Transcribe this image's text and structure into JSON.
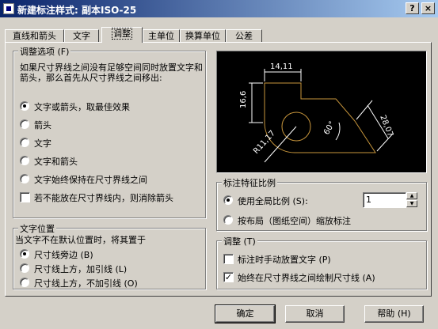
{
  "window": {
    "title": "新建标注样式: 副本ISO-25",
    "help_glyph": "?",
    "close_glyph": "×"
  },
  "tabs": [
    {
      "label": "直线和箭头"
    },
    {
      "label": "文字"
    },
    {
      "label": "调整"
    },
    {
      "label": "主单位"
    },
    {
      "label": "换算单位"
    },
    {
      "label": "公差"
    }
  ],
  "fit_options": {
    "title": "调整选项",
    "hotkey": "(F)",
    "description": "如果尺寸界线之间没有足够空间同时放置文字和箭头，那么首先从尺寸界线之间移出:",
    "options": [
      {
        "label": "文字或箭头，取最佳效果",
        "selected": true
      },
      {
        "label": "箭头",
        "selected": false
      },
      {
        "label": "文字",
        "selected": false
      },
      {
        "label": "文字和箭头",
        "selected": false
      },
      {
        "label": "文字始终保持在尺寸界线之间",
        "selected": false
      }
    ],
    "suppress_arrows": {
      "label": "若不能放在尺寸界线内，则消除箭头",
      "checked": false
    }
  },
  "text_placement": {
    "title": "文字位置",
    "description": "当文字不在默认位置时，将其置于",
    "options": [
      {
        "label": "尺寸线旁边",
        "hotkey": "(B)",
        "selected": true
      },
      {
        "label": "尺寸线上方，加引线",
        "hotkey": "(L)",
        "selected": false
      },
      {
        "label": "尺寸线上方，不加引线",
        "hotkey": "(O)",
        "selected": false
      }
    ]
  },
  "preview": {
    "dims": {
      "top": "14,11",
      "left": "16,6",
      "right": "28,07",
      "angle": "60°",
      "radius": "R11,17"
    },
    "colors": {
      "geometry": "#c8963c",
      "dimension": "#ffffff",
      "background": "#000000"
    }
  },
  "scale": {
    "title": "标注特征比例",
    "use_global": {
      "label": "使用全局比例",
      "hotkey": "(S):",
      "selected": true
    },
    "global_value": "1",
    "layout": {
      "label": "按布局（图纸空间）缩放标注",
      "selected": false
    }
  },
  "fine_tuning": {
    "title": "调整",
    "hotkey": "(T)",
    "manual": {
      "label": "标注时手动放置文字",
      "hotkey": "(P)",
      "checked": false
    },
    "always_draw": {
      "label": "始终在尺寸界线之间绘制尺寸线",
      "hotkey": "(A)",
      "checked": true
    }
  },
  "buttons": {
    "ok": "确定",
    "cancel": "取消",
    "help": "帮助",
    "help_hotkey": "(H)"
  }
}
